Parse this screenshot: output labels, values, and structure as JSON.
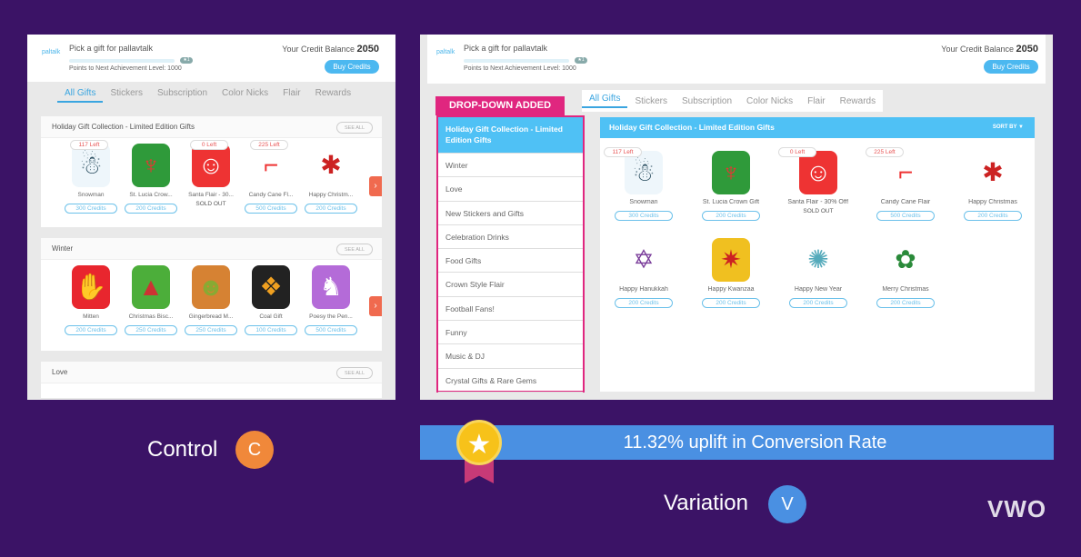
{
  "colors": {
    "background": "#3b1366",
    "accent": "#4fc1f5",
    "dropdown_border": "#e0267f",
    "banner": "#4a90e2",
    "control_badge": "#f0883a",
    "variation_badge": "#4a90e2"
  },
  "header": {
    "logo": "paltalk",
    "pick": "Pick a gift for pallavtalk",
    "level_badge": "★1",
    "points": "Points to Next Achievement Level: 1000",
    "balance_label": "Your Credit Balance",
    "balance": "2050",
    "buy": "Buy Credits"
  },
  "tabs": [
    "All Gifts",
    "Stickers",
    "Subscription",
    "Color Nicks",
    "Flair",
    "Rewards"
  ],
  "control": {
    "sections": [
      {
        "title": "Holiday Gift Collection - Limited Edition Gifts",
        "see_all": "SEE ALL",
        "items": [
          {
            "name": "Snowman",
            "credits": "300 Credits",
            "left": "117 Left",
            "icon": "snowman"
          },
          {
            "name": "St. Lucia Crow...",
            "credits": "200 Credits",
            "icon": "candle-wreath"
          },
          {
            "name": "Santa Flair - 30...",
            "sold": "SOLD OUT",
            "left": "0 Left",
            "icon": "santa"
          },
          {
            "name": "Candy Cane Fl...",
            "credits": "500 Credits",
            "left": "225 Left",
            "icon": "candy-cane"
          },
          {
            "name": "Happy Christm...",
            "credits": "200 Credits",
            "icon": "christmas-sticker"
          }
        ]
      },
      {
        "title": "Winter",
        "see_all": "SEE ALL",
        "items": [
          {
            "name": "Mitten",
            "credits": "200 Credits",
            "icon": "mitten"
          },
          {
            "name": "Christmas Bisc...",
            "credits": "250 Credits",
            "icon": "tree-cookie"
          },
          {
            "name": "Gingerbread M...",
            "credits": "250 Credits",
            "icon": "gingerbread"
          },
          {
            "name": "Coal Gift",
            "credits": "100 Credits",
            "icon": "gift-box"
          },
          {
            "name": "Poesy the Pen...",
            "credits": "500 Credits",
            "icon": "penguin"
          }
        ]
      },
      {
        "title": "Love",
        "see_all": "SEE ALL",
        "items": []
      }
    ],
    "label": "Control",
    "badge": "C"
  },
  "variation": {
    "dropdown_label": "DROP-DOWN ADDED",
    "dropdown": [
      "Holiday Gift Collection - Limited Edition Gifts",
      "Winter",
      "Love",
      "New Stickers and Gifts",
      "Celebration Drinks",
      "Food Gifts",
      "Crown Style Flair",
      "Football Fans!",
      "Funny",
      "Music & DJ",
      "Crystal Gifts & Rare Gems"
    ],
    "section_title": "Holiday Gift Collection - Limited Edition Gifts",
    "sort_by": "SORT BY ▼",
    "items": [
      {
        "name": "Snowman",
        "credits": "300 Credits",
        "left": "117 Left",
        "icon": "snowman"
      },
      {
        "name": "St. Lucia Crown Gift",
        "credits": "200 Credits",
        "icon": "candle-wreath"
      },
      {
        "name": "Santa Flair - 30% Off!",
        "sold": "SOLD OUT",
        "left": "0 Left",
        "icon": "santa"
      },
      {
        "name": "Candy Cane Flair",
        "credits": "500 Credits",
        "left": "225 Left",
        "icon": "candy-cane"
      },
      {
        "name": "Happy Christmas",
        "credits": "200 Credits",
        "icon": "christmas-sticker"
      },
      {
        "name": "Happy Hanukkah",
        "credits": "200 Credits",
        "icon": "hanukkah-sticker"
      },
      {
        "name": "Happy Kwanzaa",
        "credits": "200 Credits",
        "icon": "kwanzaa-sticker"
      },
      {
        "name": "Happy New Year",
        "credits": "200 Credits",
        "icon": "new-year-sticker"
      },
      {
        "name": "Merry Christmas",
        "credits": "200 Credits",
        "icon": "merry-christmas-sticker"
      }
    ],
    "label": "Variation",
    "badge": "V"
  },
  "banner": "11.32% uplift in Conversion Rate",
  "brand": "VWO"
}
